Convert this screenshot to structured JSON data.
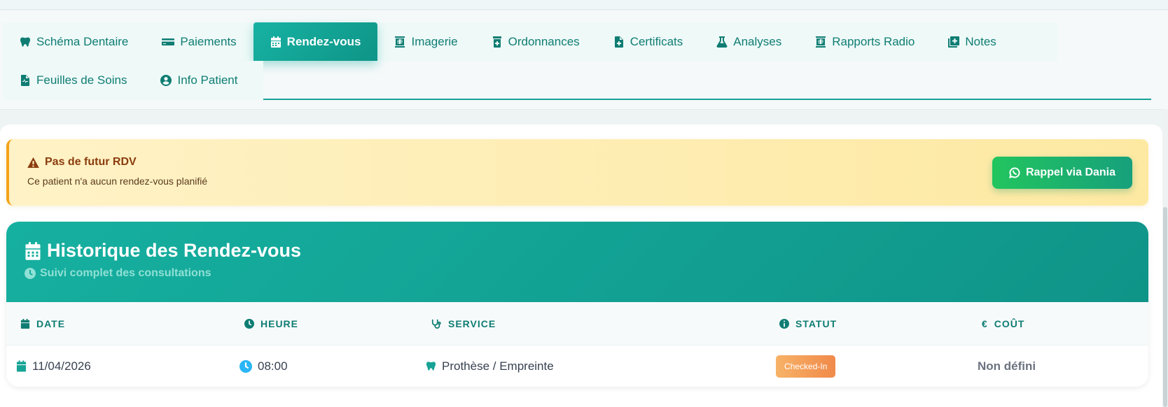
{
  "tabs": {
    "items": [
      {
        "label": "Schéma Dentaire",
        "icon": "tooth-icon"
      },
      {
        "label": "Paiements",
        "icon": "credit-card-icon"
      },
      {
        "label": "Rendez-vous",
        "icon": "calendar-icon",
        "active": true
      },
      {
        "label": "Imagerie",
        "icon": "xray-icon"
      },
      {
        "label": "Ordonnances",
        "icon": "prescription-bottle-icon"
      },
      {
        "label": "Certificats",
        "icon": "file-medical-icon"
      },
      {
        "label": "Analyses",
        "icon": "flask-icon"
      },
      {
        "label": "Rapports Radio",
        "icon": "xray-report-icon"
      },
      {
        "label": "Notes",
        "icon": "notes-icon"
      },
      {
        "label": "Feuilles de Soins",
        "icon": "file-waveform-icon"
      },
      {
        "label": "Info Patient",
        "icon": "user-circle-icon"
      }
    ]
  },
  "alert": {
    "title": "Pas de futur RDV",
    "text": "Ce patient n'a aucun rendez-vous planifié",
    "button_label": "Rappel via Dania",
    "icon": "warning-icon",
    "button_icon": "whatsapp-icon"
  },
  "history": {
    "title": "Historique des Rendez-vous",
    "subtitle": "Suivi complet des consultations",
    "columns": {
      "date": "DATE",
      "time": "HEURE",
      "service": "SERVICE",
      "status": "STATUT",
      "cost": "COÛT"
    },
    "rows": [
      {
        "date": "11/04/2026",
        "time": "08:00",
        "service": "Prothèse / Empreinte",
        "status": "Checked-In",
        "cost": "Non défini"
      }
    ]
  },
  "colors": {
    "accent": "#17a396",
    "status_checked_in": "#f08a4b",
    "alert_border": "#f4a31a",
    "button_green": "#22c55e"
  }
}
